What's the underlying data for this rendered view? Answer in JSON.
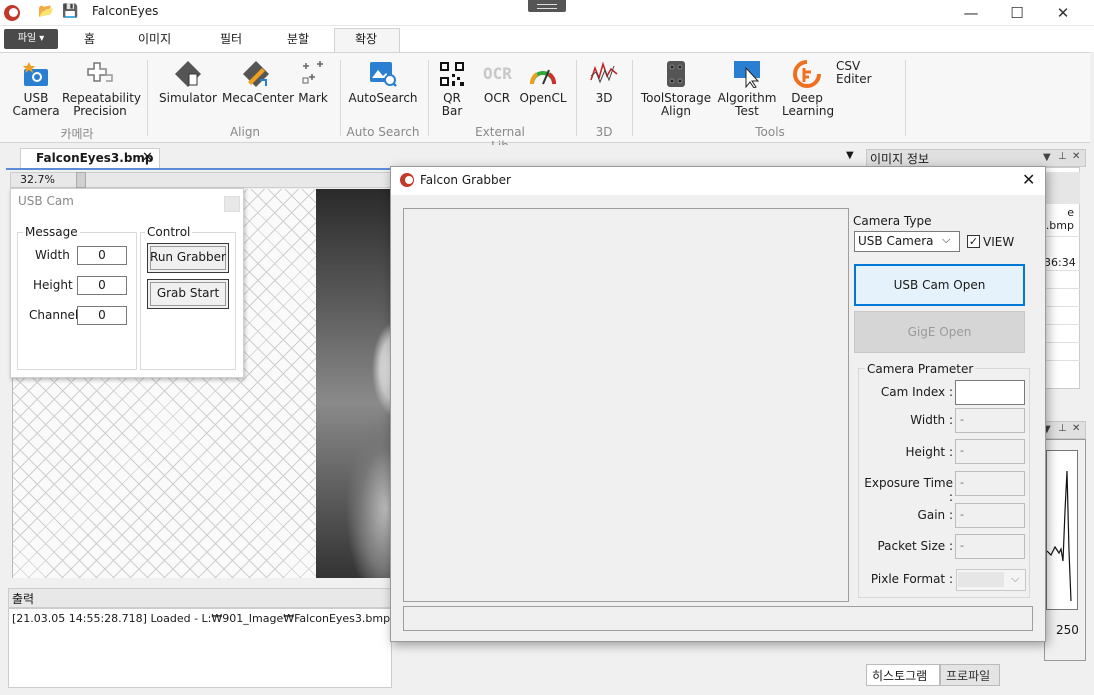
{
  "window": {
    "title": "FalconEyes",
    "minimize": "—",
    "maximize": "☐",
    "close": "✕"
  },
  "ribbon": {
    "file_menu": "파일 ▾",
    "tabs": [
      "홈",
      "이미지",
      "필터",
      "분할",
      "확장"
    ],
    "active_tab": "확장",
    "buttons": {
      "usb_camera": "USB\nCamera",
      "repeatability": "Repeatability\nPrecision",
      "simulator": "Simulator",
      "mecacenter": "MecaCenter",
      "mark": "Mark",
      "autosearch": "AutoSearch",
      "qr_bar": "QR\nBar",
      "ocr": "OCR",
      "opencl": "OpenCL",
      "three_d": "3D",
      "toolstorage": "ToolStorage\nAlign",
      "algorithm_test": "Algorithm\nTest",
      "deep_learning": "Deep\nLearning",
      "csv_editer": "CSV Editer"
    },
    "groups": {
      "camera": "카메라",
      "align": "Align",
      "auto_search": "Auto Search",
      "external_lib": "External Lib",
      "three_d": "3D",
      "tools": "Tools"
    }
  },
  "document": {
    "tab_label": "FalconEyes3.bmp",
    "zoom": "32.7%"
  },
  "usb_cam_panel": {
    "title": "USB Cam",
    "message_group": "Message",
    "control_group": "Control",
    "width_label": "Width",
    "width_value": "0",
    "height_label": "Height",
    "height_value": "0",
    "channel_label": "Channel",
    "channel_value": "0",
    "run_grabber": "Run Grabber",
    "grab_start": "Grab Start"
  },
  "output": {
    "title": "출력",
    "lines": [
      "[21.03.05 14:55:28.718] Loaded - L:₩901_Image₩FalconEyes3.bmp"
    ]
  },
  "image_info": {
    "title": "이미지 정보",
    "file_fragment": "e\n.bmp",
    "time_fragment": "36:34"
  },
  "histogram": {
    "x_label": "250",
    "tab_histogram": "히스토그램",
    "tab_profile": "프로파일"
  },
  "dialog": {
    "title": "Falcon Grabber",
    "close": "✕",
    "camera_type_label": "Camera Type",
    "camera_type_value": "USB Camera",
    "view_label": "VIEW",
    "view_checked": "✓",
    "usb_cam_open": "USB Cam Open",
    "gige_open": "GigE Open",
    "param_group": "Camera Prameter",
    "params": {
      "cam_index_label": "Cam Index :",
      "cam_index_value": "",
      "width_label": "Width :",
      "width_value": "-",
      "height_label": "Height :",
      "height_value": "-",
      "exposure_label": "Exposure Time :",
      "exposure_value": "-",
      "gain_label": "Gain :",
      "gain_value": "-",
      "packet_label": "Packet Size :",
      "packet_value": "-",
      "pixel_format_label": "Pixle Format :"
    }
  },
  "colors": {
    "accent": "#0078d7",
    "logo_red": "#c0392b",
    "doc_tab_line": "#5b8dd6"
  }
}
